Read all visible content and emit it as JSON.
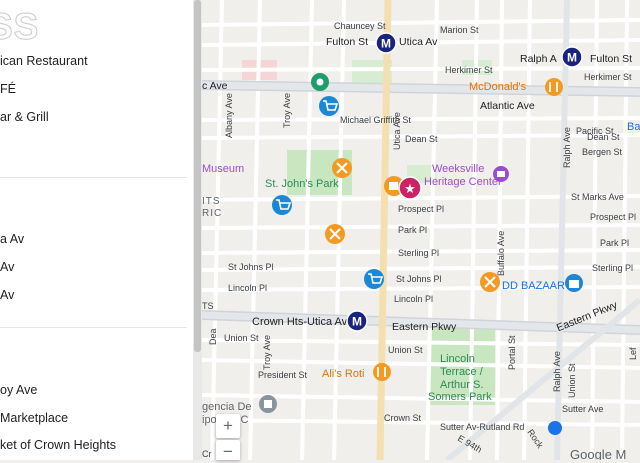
{
  "panel": {
    "title": "SS",
    "group1": [
      "ican Restaurant",
      "FÉ",
      "ar & Grill"
    ],
    "group2": [
      "a Av",
      "Av",
      "Av"
    ],
    "group3": [
      "oy Ave",
      "Marketplace",
      "ket of Crown Heights"
    ]
  },
  "streets": {
    "chauncey": "Chauncey St",
    "fulton": "Fulton St",
    "utica_av_top": "Utica Av",
    "marion": "Marion St",
    "ralph_fulton": "Ralph A",
    "fulton_st2": "Fulton St",
    "herkimer": "Herkimer St",
    "herkimer2": "Herkimer St",
    "atlantic_left": "c Ave",
    "atlantic": "Atlantic Ave",
    "albany": "Albany Ave",
    "troy": "Troy Ave",
    "michael": "Michael Griffith St",
    "dean": "Dean St",
    "dean2": "Dean St",
    "pacific": "Pacific St",
    "bergen": "Bergen St",
    "utica_ave": "Utica Ave",
    "ralph_ave": "Ralph Ave",
    "st_marks": "St Marks Ave",
    "prospect_pl": "Prospect Pl",
    "prospect_pl2": "Prospect Pl",
    "park_pl": "Park Pl",
    "park_pl2": "Park Pl",
    "sterling_pl": "Sterling Pl",
    "sterling_pl2": "Sterling Pl",
    "buffalo": "Buffalo Ave",
    "st_johns_pl": "St Johns Pl",
    "st_johns_pl2": "St Johns Pl",
    "lincoln_pl": "Lincoln Pl",
    "lincoln_pl2": "Lincoln Pl",
    "eastern_pkwy": "Eastern Pkwy",
    "eastern_pkwy2": "Eastern Pkwy",
    "union": "Union St",
    "union2": "Union St",
    "union_st_v": "Union St",
    "president": "President St",
    "portal": "Portal St",
    "ralph_ave2": "Ralph Ave",
    "crown": "Crown St",
    "sutter": "Sutter Ave",
    "sutter_rutland": "Sutter Av-Rutland Rd",
    "e94": "E 94th",
    "rock": "Rock",
    "dean_partial": "Dea",
    "crown_partial": "Cr",
    "eastern_partial": "TS",
    "lefferts": "Lef",
    "b_partial": "Ba"
  },
  "places": {
    "museum": "Museum",
    "st_johns_park": "St. John's Park",
    "weeksville": "Weeksville",
    "heritage": "Heritage Center",
    "its": "ITS",
    "ric": "RIC",
    "mcdonalds": "McDonald's",
    "bazaar": "DD BAZAAR",
    "crown_hts_utica": "Crown Hts-Utica Av",
    "alis_roti": "Ali's Roti",
    "lincoln_terrace": "Lincoln",
    "lincoln_terrace2": "Terrace /",
    "lincoln_terrace3": "Arthur S.",
    "lincoln_terrace4": "Somers Park",
    "agencia": "gencia De",
    "agencia2": "ipos NYC",
    "google": "Google M"
  },
  "icons": {
    "metro": "M",
    "restaurant": "fork-knife",
    "shopping": "shopping-cart"
  },
  "zoom": {
    "in": "+",
    "out": "−"
  },
  "colors": {
    "metro": "#1a237e",
    "restaurant": "#f39a22",
    "shopping": "#1a88d6",
    "museum": "#9b4dcf",
    "favorite": "#cc2366",
    "park": "#c8e6c0"
  }
}
